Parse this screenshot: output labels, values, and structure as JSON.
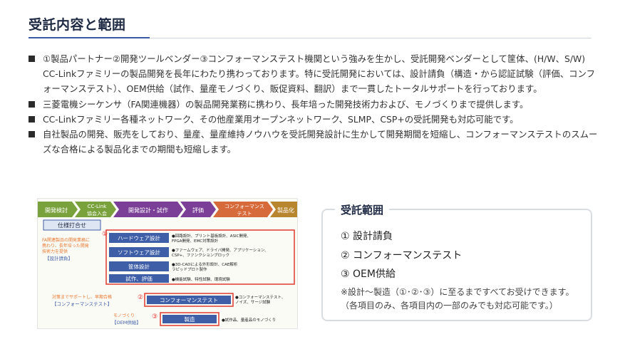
{
  "header": {
    "title": "受託内容と範囲"
  },
  "bullets": [
    "①製品パートナー②開発ツールベンダー③コンフォーマンステスト機関という強みを生かし、受託開発ベンダーとして筐体、(H/W、S/W) CC-Linkファミリーの製品開発を長年にわたり携わっております。特に受託開発においては、設計請負（構造・から認証試験（評価、コンフォーマンステスト）、OEM供給（試作、量産モノづくり、販促資料、翻訳）まで一貫したトータルサポートを行っております。",
    "三菱電機シーケンサ（FA関連機器）の製品開発業務に携わり、長年培った開発技術力および、モノづくりまで提供します。",
    "CC-Linkファミリー各種ネットワーク、その他産業用オープンネットワーク、SLMP、CSP+の受託開発も対応可能です。",
    "自社製品の開発、販売をしており、量産、量産維持ノウハウを受託開発設計に生かして開発期間を短縮し、コンフォーマンステストのスムーズな合格による製品化までの期間も短縮します。"
  ],
  "figure": {
    "steps": [
      "開発検討",
      "CC-Link\n協会入会",
      "開発設計・試作",
      "評価",
      "コンフォーマンス\nテスト",
      "製品化"
    ],
    "spec_label": "仕様打合せ",
    "left_note_1": "FA関連製品の開発業務に携わり、長年培った開発技術力を提供",
    "left_tag_1": "【設計請負】",
    "circle_1": "①",
    "circle_2": "②",
    "circle_3": "③",
    "tasks": [
      {
        "label": "ハードウェア設計",
        "desc": "●回路設計、プリント基板設計、ASIC開発、FPGA開発、EMC対策設計"
      },
      {
        "label": "ソフトウェア設計",
        "desc": "●ファームウェア、ドライバ開発、アプリケーション、CSP+、ファンクションブロック"
      },
      {
        "label": "筐体設計",
        "desc": "●3D-CADによる外形設計、CAE解析ラピッドプロト製作"
      },
      {
        "label": "試作、評価",
        "desc": "●機能試験、特性試験、環境試験"
      }
    ],
    "left_note_2": "対策までサポートし、早期合格",
    "left_tag_2": "【コンフォーマンステスト】",
    "conformance_label": "コンフォーマンステスト",
    "conformance_desc": "●コンフォーマンステスト、ノイズ、サージ試験",
    "left_note_3": "モノづくり",
    "left_tag_3": "【OEM供給】",
    "manufacturing_label": "製造",
    "manufacturing_desc": "●試作品、量産品のモノづくり"
  },
  "scope": {
    "title": "受託範囲",
    "items": [
      "① 設計請負",
      "② コンフォーマンステスト",
      "③ OEM供給"
    ],
    "note": "※設計～製造（①･②･③）に至るまですべてお受けできます。\n（各項目のみ、各項目内の一部のみでも対応可能です。）"
  },
  "colors": {
    "accent": "#3b5aa6",
    "step_green": "#7aa23c",
    "step_purple": "#7b3f98",
    "box_red": "#e03a2f",
    "task_blue": "#3f5ea8",
    "note_orange": "#e8772e"
  }
}
